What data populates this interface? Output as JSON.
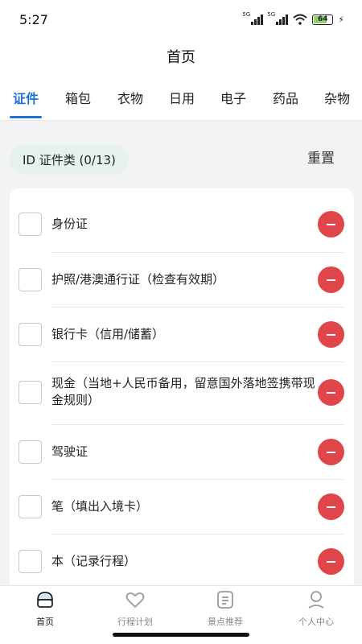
{
  "status_bar": {
    "time": "5:27",
    "signal1_label": "5G",
    "signal2_label": "5G",
    "battery": "64"
  },
  "header": {
    "title": "首页"
  },
  "tabs": [
    {
      "label": "证件",
      "active": true
    },
    {
      "label": "箱包"
    },
    {
      "label": "衣物"
    },
    {
      "label": "日用"
    },
    {
      "label": "电子"
    },
    {
      "label": "药品"
    },
    {
      "label": "杂物"
    }
  ],
  "category": {
    "chip_label": "ID  证件类 (0/13)",
    "reset_label": "重置"
  },
  "items": [
    {
      "text": "身份证"
    },
    {
      "text": "护照/港澳通行证（检查有效期）"
    },
    {
      "text": "银行卡（信用/储蓄）"
    },
    {
      "text": "现金（当地+人民币备用，留意国外落地签携带现金规则）"
    },
    {
      "text": "驾驶证"
    },
    {
      "text": "笔（填出入境卡）"
    },
    {
      "text": "本（记录行程）"
    }
  ],
  "bottom_nav": [
    {
      "label": "首页",
      "icon": "home-icon",
      "active": true
    },
    {
      "label": "行程计划",
      "icon": "heart-icon"
    },
    {
      "label": "景点推荐",
      "icon": "document-icon"
    },
    {
      "label": "个人中心",
      "icon": "person-icon"
    }
  ],
  "colors": {
    "accent": "#1e6fd9",
    "danger": "#e0454a",
    "chip_bg": "#e6f1ee"
  }
}
